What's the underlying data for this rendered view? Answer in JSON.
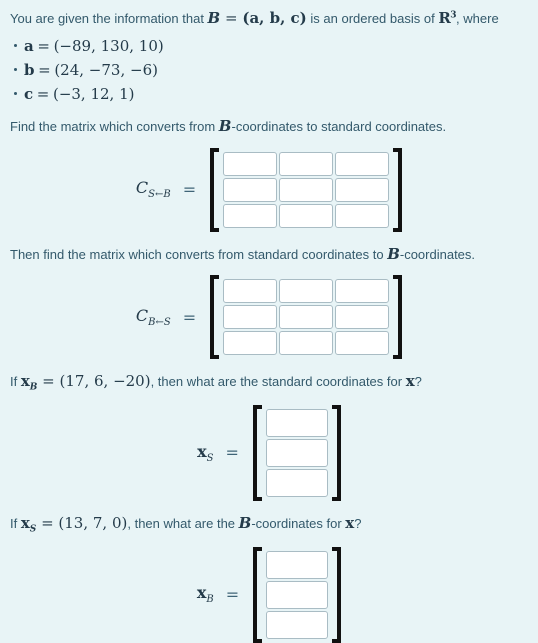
{
  "problem": {
    "intro_before": "You are given the information that ",
    "intro_basis_symbol": "B",
    "intro_eq": " = ",
    "intro_tuple": "(a, b, c)",
    "intro_after": " is an ordered basis of ",
    "intro_space_base": "R",
    "intro_space_exp": "3",
    "intro_end": ", where",
    "vectors": [
      {
        "name": "a",
        "equals": "=",
        "value": "(−89, 130, 10)"
      },
      {
        "name": "b",
        "equals": "=",
        "value": "(24, −73, −6)"
      },
      {
        "name": "c",
        "equals": "=",
        "value": "(−3, 12, 1)"
      }
    ],
    "questions": [
      {
        "id": "q1",
        "text_parts": {
          "before": "Find the matrix which converts from ",
          "symbol": "B",
          "after": "-coordinates to standard coordinates."
        },
        "answer": {
          "kind": "matrix",
          "label_main": "C",
          "label_sub": "S←B",
          "equals": "=",
          "rows": 3,
          "cols": 3,
          "values": [
            [
              "",
              "",
              ""
            ],
            [
              "",
              "",
              ""
            ],
            [
              "",
              "",
              ""
            ]
          ]
        }
      },
      {
        "id": "q2",
        "text_parts": {
          "before": "Then find the matrix which converts from standard coordinates to ",
          "symbol": "B",
          "after": "-coordinates."
        },
        "answer": {
          "kind": "matrix",
          "label_main": "C",
          "label_sub": "B←S",
          "equals": "=",
          "rows": 3,
          "cols": 3,
          "values": [
            [
              "",
              "",
              ""
            ],
            [
              "",
              "",
              ""
            ],
            [
              "",
              "",
              ""
            ]
          ]
        }
      },
      {
        "id": "q3",
        "text_parts": {
          "before": "If ",
          "var_main": "x",
          "var_sub": "B",
          "eq": " = ",
          "given": "(17, 6, −20)",
          "after": ", then what are the standard coordinates for ",
          "var_tail": "x",
          "after2": "?"
        },
        "answer": {
          "kind": "vector",
          "label_main": "x",
          "label_sub": "S",
          "equals": "=",
          "rows": 3,
          "cols": 1,
          "values": [
            [
              ""
            ],
            [
              ""
            ],
            [
              ""
            ]
          ]
        }
      },
      {
        "id": "q4",
        "text_parts": {
          "before": "If ",
          "var_main": "x",
          "var_sub": "S",
          "eq": " = ",
          "given": "(13, 7, 0)",
          "after": ", then what are the ",
          "symbol": "B",
          "after2": "-coordinates for ",
          "var_tail": "x",
          "after3": "?"
        },
        "answer": {
          "kind": "vector",
          "label_main": "x",
          "label_sub": "B",
          "equals": "=",
          "rows": 3,
          "cols": 1,
          "values": [
            [
              ""
            ],
            [
              ""
            ],
            [
              ""
            ]
          ]
        }
      }
    ]
  },
  "colors": {
    "background": "#e8f4f6",
    "text": "#33596b",
    "math": "#243b4a",
    "bracket": "#111111",
    "input_border": "#a9bcc4",
    "input_background": "#ffffff"
  }
}
